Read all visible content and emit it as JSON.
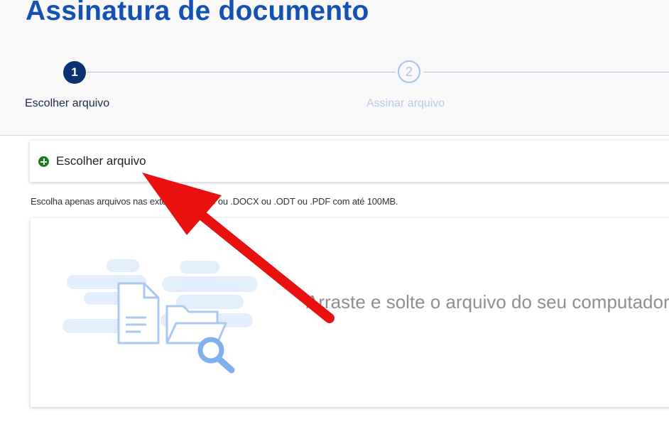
{
  "header": {
    "title": "Assinatura de documento"
  },
  "stepper": {
    "steps": [
      {
        "number": "1",
        "label": "Escolher arquivo",
        "state": "active"
      },
      {
        "number": "2",
        "label": "Assinar arquivo",
        "state": "inactive"
      }
    ]
  },
  "upload": {
    "choose_label": "Escolher arquivo",
    "hint": "Escolha apenas arquivos nas extensões .DOC ou .DOCX ou .ODT ou .PDF com até 100MB.",
    "dropzone_text": "Arraste e solte o arquivo do seu computador",
    "icons": [
      "plus-circle-icon",
      "document-icon",
      "folder-icon",
      "search-icon"
    ]
  },
  "colors": {
    "title": "#1451b4",
    "active_step": "#0c326f",
    "inactive_step": "#a8c2ee",
    "add_icon": "#1a7d1e",
    "annotation_arrow": "#e8110f"
  }
}
